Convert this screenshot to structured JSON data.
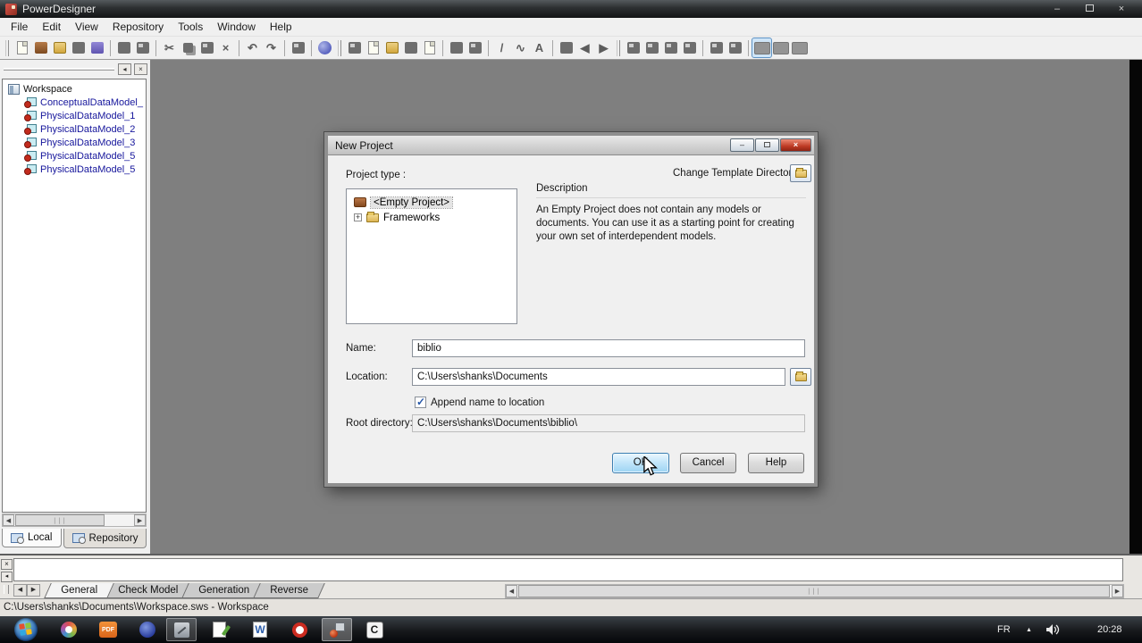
{
  "window": {
    "title": "PowerDesigner"
  },
  "menu": {
    "items": [
      "File",
      "Edit",
      "View",
      "Repository",
      "Tools",
      "Window",
      "Help"
    ]
  },
  "icons": {
    "minimize": "–",
    "close": "×",
    "cut": "✂",
    "delete": "×",
    "undo": "↶",
    "redo": "↷",
    "line": "/",
    "arc": "∿",
    "text": "A",
    "font": "A",
    "arrow_left": "◀",
    "arrow_right": "▶",
    "up": "▲",
    "down": "▼",
    "plus": "+",
    "check": "✓",
    "grip": "|||",
    "pin": "◂",
    "tray_expand": "▲"
  },
  "workspace_panel": {
    "root_label": "Workspace",
    "models": [
      "ConceptualDataModel_",
      "PhysicalDataModel_1",
      "PhysicalDataModel_2",
      "PhysicalDataModel_3",
      "PhysicalDataModel_5",
      "PhysicalDataModel_5"
    ],
    "tabs": {
      "local": "Local",
      "repository": "Repository"
    }
  },
  "dialog": {
    "title": "New Project",
    "project_type_label": "Project type :",
    "change_template_label": "Change Template Directory:",
    "tree": {
      "empty_project": "<Empty Project>",
      "frameworks": "Frameworks"
    },
    "description": {
      "title": "Description",
      "text": "An Empty Project does not contain any models or documents. You can use it as a starting point for creating your own set of interdependent models."
    },
    "name_label": "Name:",
    "name_value": "biblio",
    "location_label": "Location:",
    "location_value": "C:\\Users\\shanks\\Documents",
    "append_label": "Append name to location",
    "append_checked": true,
    "root_label": "Root directory:",
    "root_value": "C:\\Users\\shanks\\Documents\\biblio\\",
    "buttons": {
      "ok": "OK",
      "cancel": "Cancel",
      "help": "Help"
    }
  },
  "output_panel": {
    "tabs": [
      "General",
      "Check Model",
      "Generation",
      "Reverse"
    ]
  },
  "status_bar": {
    "text": "C:\\Users\\shanks\\Documents\\Workspace.sws - Workspace"
  },
  "taskbar": {
    "pdf_label": "PDF",
    "word_label": "W",
    "c_label": "C",
    "tray": {
      "language": "FR",
      "time": "20:28"
    }
  },
  "colors": {
    "accent_blue": "#9cd4f3",
    "close_red": "#bd3a24",
    "canvas_gray": "#7f7f7f",
    "taskbar_black": "#111418"
  }
}
